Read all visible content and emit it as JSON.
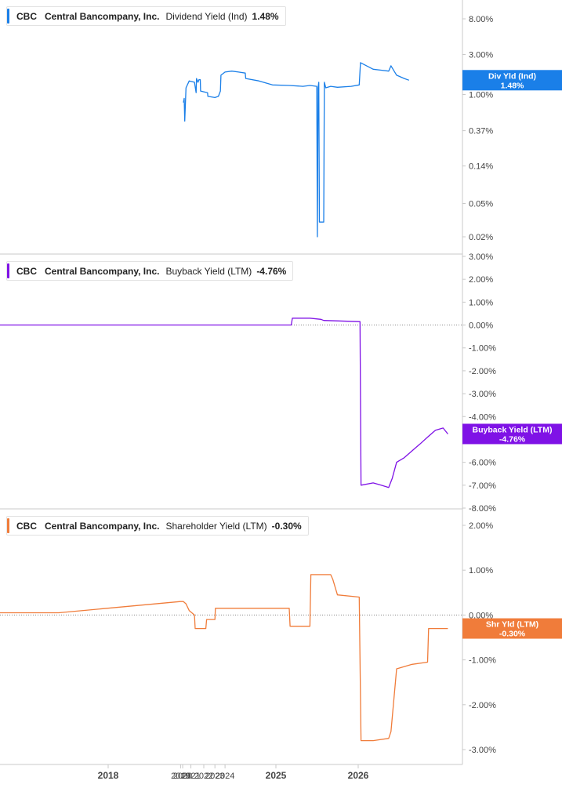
{
  "chart_data": [
    {
      "type": "line",
      "ticker": "CBC",
      "company": "Central Bancompany, Inc.",
      "metric": "Dividend Yield (Ind)",
      "current_value": "1.48%",
      "flag_label": "Div Yld (Ind)",
      "flag_value": "1.48%",
      "color": "#1a7fe8",
      "scale": "log",
      "ylim": [
        0.02,
        10
      ],
      "yticks": [
        "8.00%",
        "3.00%",
        "1.00%",
        "0.37%",
        "0.14%",
        "0.05%",
        "0.02%"
      ],
      "ytick_values": [
        8.0,
        3.0,
        1.0,
        0.37,
        0.14,
        0.05,
        0.02
      ],
      "series": [
        {
          "x": [
            "2023-01-01",
            "2023-01-05",
            "2023-01-08",
            "2023-01-15",
            "2023-02-01",
            "2023-03-01",
            "2023-03-10",
            "2023-03-12",
            "2023-03-20",
            "2023-03-25",
            "2023-04-01",
            "2023-04-03",
            "2023-05-10",
            "2023-05-12",
            "2023-07-01",
            "2023-08-01",
            "2023-08-20",
            "2023-08-25",
            "2023-10-01",
            "2023-12-01",
            "2024-02-01",
            "2024-04-01",
            "2024-04-05",
            "2024-08-01",
            "2024-12-01",
            "2025-03-01",
            "2025-05-01",
            "2025-06-01",
            "2025-07-01",
            "2025-07-04",
            "2025-07-07",
            "2025-07-10",
            "2025-07-13",
            "2025-08-01",
            "2025-08-04",
            "2025-08-07",
            "2025-08-10",
            "2025-09-01",
            "2025-10-01",
            "2025-12-01",
            "2026-01-05",
            "2026-01-10",
            "2026-03-01",
            "2026-04-01",
            "2026-05-01",
            "2026-05-10",
            "2026-06-01",
            "2026-07-01",
            "2026-07-20"
          ],
          "values": [
            0.8,
            0.9,
            0.48,
            1.2,
            1.45,
            1.4,
            1.05,
            1.55,
            1.4,
            1.5,
            1.5,
            1.1,
            1.05,
            0.95,
            0.92,
            0.95,
            1.1,
            1.7,
            1.85,
            1.9,
            1.85,
            1.8,
            1.55,
            1.45,
            1.3,
            1.28,
            1.25,
            1.28,
            1.25,
            0.02,
            1.2,
            1.4,
            0.03,
            0.03,
            1.4,
            1.3,
            1.2,
            1.25,
            1.22,
            1.25,
            1.3,
            2.4,
            2.0,
            1.95,
            1.9,
            2.2,
            1.7,
            1.55,
            1.48
          ]
        }
      ]
    },
    {
      "type": "line",
      "ticker": "CBC",
      "company": "Central Bancompany, Inc.",
      "metric": "Buyback Yield (LTM)",
      "current_value": "-4.76%",
      "flag_label": "Buyback Yield (LTM)",
      "flag_value": "-4.76%",
      "color": "#7f12e6",
      "scale": "linear",
      "ylim": [
        -8,
        3
      ],
      "yticks": [
        "3.00%",
        "2.00%",
        "1.00%",
        "0.00%",
        "-1.00%",
        "-2.00%",
        "-3.00%",
        "-4.00%",
        "-5.00%",
        "-6.00%",
        "-7.00%",
        "-8.00%"
      ],
      "ytick_values": [
        3,
        2,
        1,
        0,
        -1,
        -2,
        -3,
        -4,
        -5,
        -6,
        -7,
        -8
      ],
      "series": [
        {
          "x": [
            "2016-03-01",
            "2025-03-01",
            "2025-03-10",
            "2025-03-15",
            "2025-06-01",
            "2025-07-20",
            "2025-08-01",
            "2026-01-05",
            "2026-01-08",
            "2026-01-12",
            "2026-03-01",
            "2026-04-01",
            "2026-05-01",
            "2026-05-15",
            "2026-06-01",
            "2026-07-01",
            "2026-08-01",
            "2026-09-01",
            "2026-10-01",
            "2026-11-01",
            "2026-12-01",
            "2026-12-20"
          ],
          "values": [
            0.0,
            0.0,
            0.0,
            0.3,
            0.3,
            0.25,
            0.2,
            0.15,
            0.15,
            -7.0,
            -6.9,
            -7.0,
            -7.1,
            -6.7,
            -6.0,
            -5.8,
            -5.5,
            -5.2,
            -4.9,
            -4.6,
            -4.5,
            -4.76
          ]
        }
      ]
    },
    {
      "type": "line",
      "ticker": "CBC",
      "company": "Central Bancompany, Inc.",
      "metric": "Shareholder Yield (LTM)",
      "current_value": "-0.30%",
      "flag_label": "Shr Yld (LTM)",
      "flag_value": "-0.30%",
      "color": "#f07c3a",
      "scale": "linear",
      "ylim": [
        -3.3,
        2.2
      ],
      "yticks": [
        "2.00%",
        "1.00%",
        "0.00%",
        "-1.00%",
        "-2.00%",
        "-3.00%"
      ],
      "ytick_values": [
        2,
        1,
        0,
        -1,
        -2,
        -3
      ],
      "series": [
        {
          "x": [
            "2016-03-01",
            "2017-03-01",
            "2022-10-01",
            "2023-01-01",
            "2023-01-15",
            "2023-02-01",
            "2023-03-01",
            "2023-03-05",
            "2023-05-01",
            "2023-05-05",
            "2023-07-01",
            "2023-07-05",
            "2024-06-01",
            "2025-03-01",
            "2025-03-05",
            "2025-06-01",
            "2025-06-05",
            "2025-09-01",
            "2025-09-10",
            "2025-10-01",
            "2026-01-05",
            "2026-01-12",
            "2026-03-01",
            "2026-05-01",
            "2026-05-10",
            "2026-06-01",
            "2026-08-01",
            "2026-10-01",
            "2026-10-05",
            "2026-12-20"
          ],
          "values": [
            0.05,
            0.05,
            0.3,
            0.3,
            0.25,
            0.1,
            0.0,
            -0.3,
            -0.3,
            -0.1,
            -0.1,
            0.15,
            0.15,
            0.15,
            -0.25,
            -0.25,
            0.9,
            0.9,
            0.8,
            0.45,
            0.4,
            -2.8,
            -2.8,
            -2.75,
            -2.6,
            -1.2,
            -1.1,
            -1.05,
            -0.3,
            -0.3
          ]
        }
      ]
    }
  ],
  "x_axis": {
    "ticks": [
      {
        "label": "2018",
        "date": "2018-01-01",
        "bold": true
      },
      {
        "label": "2019",
        "date": "2022-10-10",
        "bold": false
      },
      {
        "label": "2020",
        "date": "2022-12-10",
        "bold": false
      },
      {
        "label": "2021",
        "date": "2023-02-10",
        "bold": false
      },
      {
        "label": "2022",
        "date": "2023-04-20",
        "bold": false
      },
      {
        "label": "2023",
        "date": "2023-07-01",
        "bold": false
      },
      {
        "label": "2024",
        "date": "2023-10-01",
        "bold": false
      },
      {
        "label": "2025",
        "date": "2025-01-01",
        "bold": true
      },
      {
        "label": "2026",
        "date": "2026-01-01",
        "bold": true
      }
    ]
  },
  "colors": {
    "grid_border": "#c8c8c8",
    "zero_line": "#888888",
    "axis_text": "#444444"
  }
}
